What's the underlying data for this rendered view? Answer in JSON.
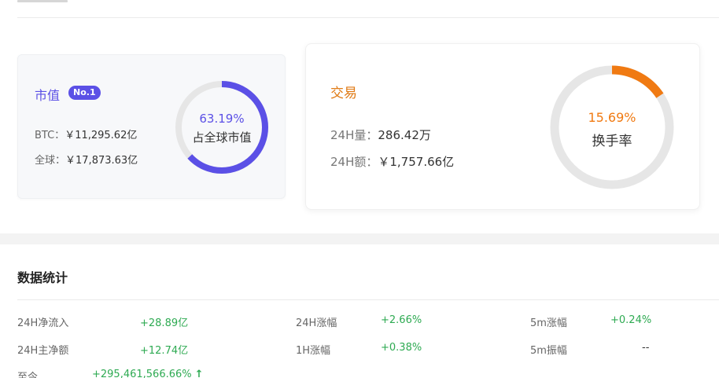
{
  "market_cap": {
    "title": "市值",
    "rank_badge": "No.1",
    "btc_label": "BTC：",
    "btc_value": "￥11,295.62亿",
    "global_label": "全球：",
    "global_value": "￥17,873.63亿",
    "share_percent": "63.19%",
    "share_fraction": 0.6319,
    "share_label": "占全球市值"
  },
  "trade": {
    "title": "交易",
    "volume_label": "24H量：",
    "volume_value": "286.42万",
    "amount_label": "24H额：",
    "amount_value": "￥1,757.66亿",
    "turnover_percent": "15.69%",
    "turnover_fraction": 0.1569,
    "turnover_label": "换手率"
  },
  "stats": {
    "title": "数据统计",
    "rows": [
      [
        {
          "label": "24H净流入",
          "value": "+28.89亿"
        },
        {
          "label": "24H涨幅",
          "value": "+2.66%"
        },
        {
          "label": "5m涨幅",
          "value": "+0.24%"
        }
      ],
      [
        {
          "label": "24H主净额",
          "value": "+12.74亿"
        },
        {
          "label": "1H涨幅",
          "value": "+0.38%"
        },
        {
          "label": "5m振幅",
          "value": "--"
        }
      ],
      [
        {
          "label": "至今",
          "value": "+295,461,566.66%"
        }
      ]
    ],
    "up_arrow_icon": "arrow-up-icon"
  },
  "colors": {
    "purple": "#5b50e6",
    "orange": "#f07a12",
    "green": "#2eaa52",
    "ring_bg": "#e6e6e6"
  }
}
